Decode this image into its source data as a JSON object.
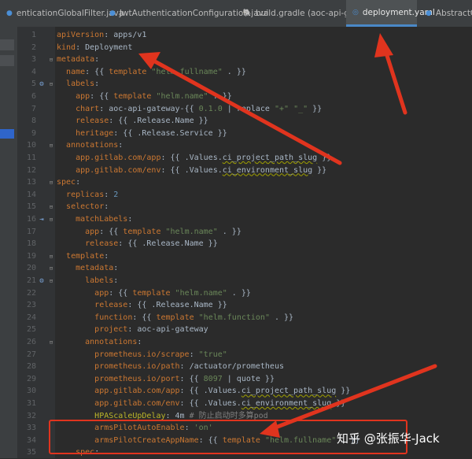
{
  "tabs": [
    {
      "label": "enticationGlobalFilter.java",
      "icon": "java-class-icon",
      "active": false
    },
    {
      "label": "JwtAuthenticationConfiguration.java",
      "icon": "java-class-icon",
      "active": false
    },
    {
      "label": "build.gradle (aoc-api-gateway)",
      "icon": "gradle-elephant-icon",
      "active": false
    },
    {
      "label": "deployment.yaml",
      "icon": "yaml-file-icon",
      "active": true
    },
    {
      "label": "AbstractGlobal",
      "icon": "java-class-icon",
      "active": false
    }
  ],
  "lines": [
    {
      "n": "1",
      "html": "<span class='k'>apiVersion</span><span class='v'>: apps/v1</span>"
    },
    {
      "n": "2",
      "html": "<span class='k'>kind</span><span class='v'>: Deployment</span>"
    },
    {
      "n": "3",
      "html": "<span class='k'>metadata</span><span class='v'>:</span>"
    },
    {
      "n": "4",
      "html": "  <span class='k'>name</span><span class='v'>: {{ </span><span class='k'>template</span><span class='v'> </span><span class='s'>\"helm.fullname\"</span><span class='v'> . }}</span>"
    },
    {
      "n": "5",
      "html": "  <span class='k'>labels</span><span class='v'>:</span>"
    },
    {
      "n": "6",
      "html": "    <span class='k'>app</span><span class='v'>: {{ </span><span class='k'>template</span><span class='v'> </span><span class='s'>\"helm.name\"</span><span class='v'> . }}</span>"
    },
    {
      "n": "7",
      "html": "    <span class='k'>chart</span><span class='v'>: aoc-api-gateway-{{ </span><span class='s'>0.1.0</span><span class='v'> | replace </span><span class='s'>\"+\" \"_\"</span><span class='v'> }}</span>"
    },
    {
      "n": "8",
      "html": "    <span class='k'>release</span><span class='v'>: {{ .Release.Name }}</span>"
    },
    {
      "n": "9",
      "html": "    <span class='k'>heritage</span><span class='v'>: {{ .Release.Service }}</span>"
    },
    {
      "n": "10",
      "html": "  <span class='k'>annotations</span><span class='v'>:</span>"
    },
    {
      "n": "11",
      "html": "    <span class='k'>app.gitlab.com/app</span><span class='v'>: {{ .Values.</span><span class='u'>ci_project_path_slug</span><span class='v'> }}</span>"
    },
    {
      "n": "12",
      "html": "    <span class='k'>app.gitlab.com/env</span><span class='v'>: {{ .Values.</span><span class='u'>ci_environment_slug</span><span class='v'> }}</span>"
    },
    {
      "n": "13",
      "html": "<span class='k'>spec</span><span class='v'>:</span>"
    },
    {
      "n": "14",
      "html": "  <span class='k'>replicas</span><span class='v'>: </span><span class='n'>2</span>"
    },
    {
      "n": "15",
      "html": "  <span class='k'>selector</span><span class='v'>:</span>"
    },
    {
      "n": "16",
      "html": "    <span class='k'>matchLabels</span><span class='v'>:</span>"
    },
    {
      "n": "17",
      "html": "      <span class='k'>app</span><span class='v'>: {{ </span><span class='k'>template</span><span class='v'> </span><span class='s'>\"helm.name\"</span><span class='v'> . }}</span>"
    },
    {
      "n": "18",
      "html": "      <span class='k'>release</span><span class='v'>: {{ .Release.Name }}</span>"
    },
    {
      "n": "19",
      "html": "  <span class='k'>template</span><span class='v'>:</span>"
    },
    {
      "n": "20",
      "html": "    <span class='k'>metadata</span><span class='v'>:</span>"
    },
    {
      "n": "21",
      "html": "      <span class='k'>labels</span><span class='v'>:</span>"
    },
    {
      "n": "22",
      "html": "        <span class='k'>app</span><span class='v'>: {{ </span><span class='k'>template</span><span class='v'> </span><span class='s'>\"helm.name\"</span><span class='v'> . }}</span>"
    },
    {
      "n": "23",
      "html": "        <span class='k'>release</span><span class='v'>: {{ .Release.Name }}</span>"
    },
    {
      "n": "24",
      "html": "        <span class='k'>function</span><span class='v'>: {{ </span><span class='k'>template</span><span class='v'> </span><span class='s'>\"helm.function\"</span><span class='v'> . }}</span>"
    },
    {
      "n": "25",
      "html": "        <span class='k'>project</span><span class='v'>: aoc-api-gateway</span>"
    },
    {
      "n": "26",
      "html": "      <span class='k'>annotations</span><span class='v'>:</span>"
    },
    {
      "n": "27",
      "html": "        <span class='k'>prometheus.io/scrape</span><span class='v'>: </span><span class='s'>\"true\"</span>"
    },
    {
      "n": "28",
      "html": "        <span class='k'>prometheus.io/path</span><span class='v'>: /actuator/prometheus</span>"
    },
    {
      "n": "29",
      "html": "        <span class='k'>prometheus.io/port</span><span class='v'>: {{ </span><span class='s'>8097</span><span class='v'> | quote }}</span>"
    },
    {
      "n": "30",
      "html": "        <span class='k'>app.gitlab.com/app</span><span class='v'>: {{ .Values.</span><span class='u'>ci_project_path_slug</span><span class='v'> }}</span>"
    },
    {
      "n": "31",
      "html": "        <span class='k'>app.gitlab.com/env</span><span class='v'>: {{ .Values.</span><span class='u'>ci_environment_slug</span><span class='v'> }}</span>"
    },
    {
      "n": "32",
      "html": "        <span class='hl'>HPAScaleUpDelay</span><span class='v'>: 4m </span><span class='c'># 防止启动时多算pod</span>"
    },
    {
      "n": "33",
      "html": "        <span class='k'>armsPilotAutoEnable</span><span class='v'>: </span><span class='s'>'on'</span>"
    },
    {
      "n": "34",
      "html": "        <span class='k'>armsPilotCreateAppName</span><span class='v'>: {{ </span><span class='k'>template</span><span class='v'> </span><span class='s'>\"helm.fullname\"</span><span class='v'> . }}</span>"
    },
    {
      "n": "35",
      "html": "    <span class='k'>spec</span><span class='v'>:</span>"
    }
  ],
  "gutter_icons": [
    {
      "line": "5",
      "icon": "override-marker-icon",
      "glyph": "⚙"
    },
    {
      "line": "16",
      "icon": "implemented-arrow-icon",
      "glyph": "⇥"
    },
    {
      "line": "21",
      "icon": "override-marker-icon",
      "glyph": "⚙"
    }
  ],
  "watermark": "知乎 @张振华-Jack",
  "colors": {
    "annotation_red": "#e0341e",
    "active_tab_underline": "#4a88c7"
  }
}
